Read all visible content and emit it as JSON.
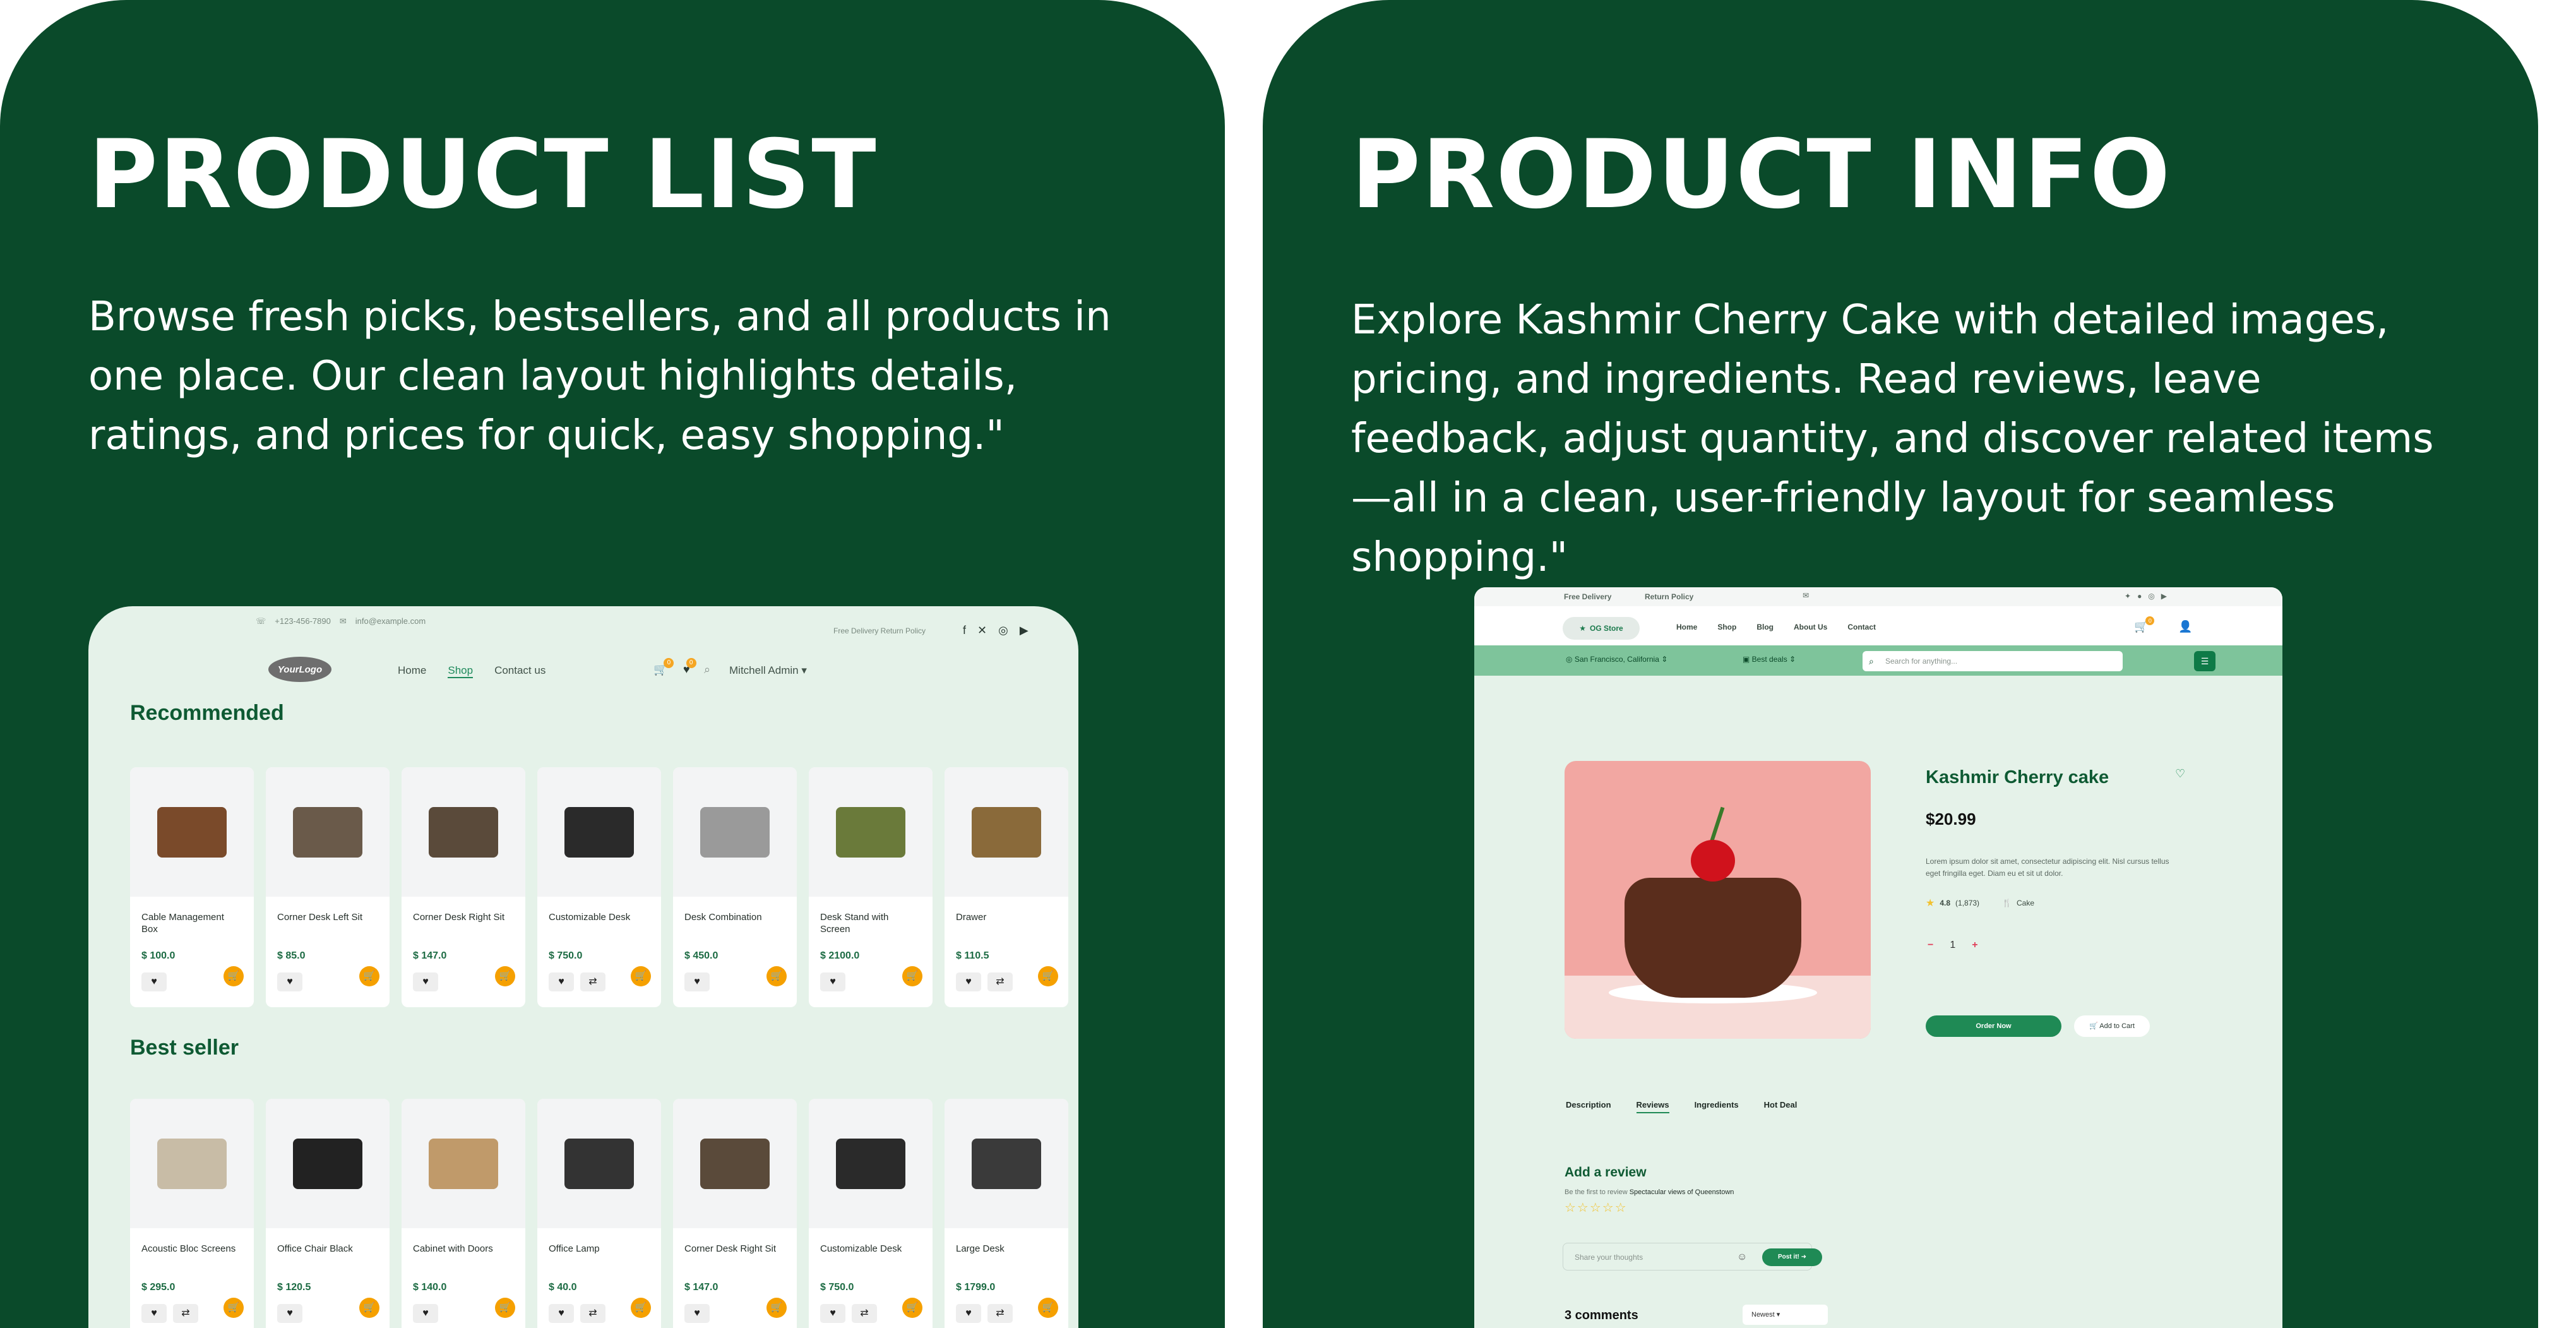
{
  "left": {
    "title": "PRODUCT LIST",
    "description": "Browse fresh picks, bestsellers, and all products in one place. Our clean layout highlights details, ratings, and prices for quick, easy shopping.\"",
    "mockup": {
      "phone": "+123-456-7890",
      "email": "info@example.com",
      "policy": "Free Delivery   Return Policy",
      "logo": "YourLogo",
      "nav": [
        "Home",
        "Shop",
        "Contact us"
      ],
      "cart_count": "0",
      "wish_count": "0",
      "user": "Mitchell Admin ▾",
      "recommended_title": "Recommended",
      "recommended": [
        {
          "name": "Cable Management Box",
          "price": "$ 100.0"
        },
        {
          "name": "Corner Desk Left Sit",
          "price": "$ 85.0"
        },
        {
          "name": "Corner Desk Right Sit",
          "price": "$ 147.0"
        },
        {
          "name": "Customizable Desk",
          "price": "$ 750.0"
        },
        {
          "name": "Desk Combination",
          "price": "$ 450.0"
        },
        {
          "name": "Desk Stand with Screen",
          "price": "$ 2100.0"
        },
        {
          "name": "Drawer",
          "price": "$ 110.5"
        }
      ],
      "bestseller_title": "Best seller",
      "bestseller": [
        {
          "name": "Acoustic Bloc Screens",
          "price": "$ 295.0"
        },
        {
          "name": "Office Chair Black",
          "price": "$ 120.5"
        },
        {
          "name": "Cabinet with Doors",
          "price": "$ 140.0"
        },
        {
          "name": "Office Lamp",
          "price": "$ 40.0"
        },
        {
          "name": "Corner Desk Right Sit",
          "price": "$ 147.0"
        },
        {
          "name": "Customizable Desk",
          "price": "$ 750.0"
        },
        {
          "name": "Large Desk",
          "price": "$ 1799.0"
        }
      ]
    }
  },
  "right": {
    "title": "PRODUCT INFO",
    "description": "Explore Kashmir Cherry Cake with detailed images, pricing, and ingredients. Read reviews, leave feedback, adjust quantity, and discover related items—all in a clean, user-friendly layout for seamless shopping.\"",
    "mockup": {
      "top_links": [
        "Free Delivery",
        "Return Policy"
      ],
      "store": "OG Store",
      "nav": [
        "Home",
        "Shop",
        "Blog",
        "About Us",
        "Contact"
      ],
      "cart_count": "0",
      "location": "San Francisco, California",
      "deals": "Best deals",
      "search_placeholder": "Search for anything...",
      "product_name": "Kashmir Cherry cake",
      "price": "$20.99",
      "desc": "Lorem ipsum dolor sit amet, consectetur adipiscing elit. Nisl cursus tellus eget fringilla eget. Diam eu et sit ut dolor.",
      "rating": "4.8",
      "rating_count": "(1,873)",
      "category": "Cake",
      "qty": "1",
      "order_label": "Order Now",
      "add_label": "Add to Cart",
      "tabs": [
        "Description",
        "Reviews",
        "Ingredients",
        "Hot Deal"
      ],
      "review_title": "Add a review",
      "review_sub": "Be the first to review",
      "review_sub_bold": "Spectacular views of Queenstown",
      "review_placeholder": "Share your thoughts",
      "post_label": "Post it!",
      "comments": "3 comments",
      "sort": "Newest"
    }
  },
  "colors": {
    "panel": "#0a4a2a",
    "accent": "#1f8a55",
    "orange": "#f5a000"
  }
}
